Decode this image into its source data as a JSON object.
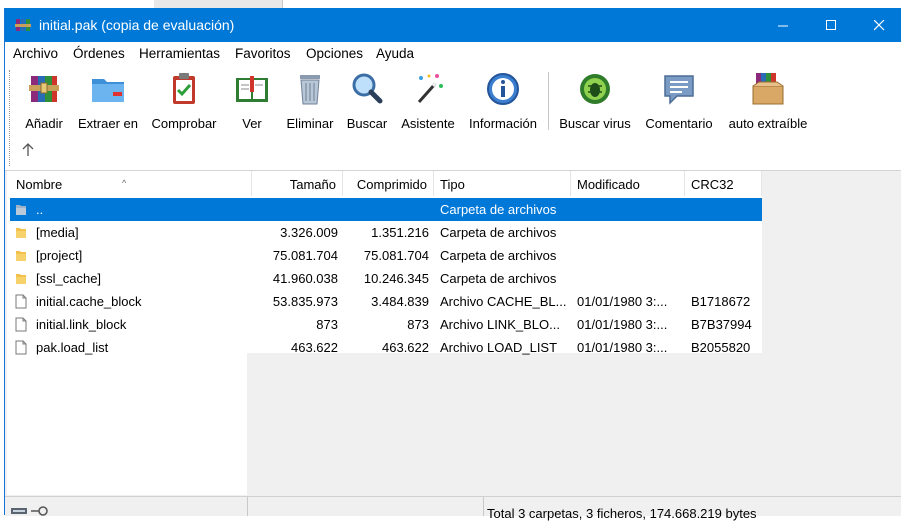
{
  "window": {
    "title": "initial.pak (copia de evaluación)"
  },
  "menu": [
    "Archivo",
    "Órdenes",
    "Herramientas",
    "Favoritos",
    "Opciones",
    "Ayuda"
  ],
  "toolbar": {
    "add": "Añadir",
    "extract": "Extraer en",
    "test": "Comprobar",
    "view": "Ver",
    "delete": "Eliminar",
    "find": "Buscar",
    "wizard": "Asistente",
    "info": "Información",
    "virus": "Buscar virus",
    "comment": "Comentario",
    "sfx": "auto extraíble"
  },
  "columns": {
    "name": "Nombre",
    "size": "Tamaño",
    "packed": "Comprimido",
    "type": "Tipo",
    "modified": "Modificado",
    "crc": "CRC32"
  },
  "files": [
    {
      "name": "..",
      "size": "",
      "packed": "",
      "type": "Carpeta de archivos",
      "modified": "",
      "crc": "",
      "icon": "parent-folder-icon",
      "selected": true
    },
    {
      "name": "[media]",
      "size": "3.326.009",
      "packed": "1.351.216",
      "type": "Carpeta de archivos",
      "modified": "",
      "crc": "",
      "icon": "folder-icon"
    },
    {
      "name": "[project]",
      "size": "75.081.704",
      "packed": "75.081.704",
      "type": "Carpeta de archivos",
      "modified": "",
      "crc": "",
      "icon": "folder-icon"
    },
    {
      "name": "[ssl_cache]",
      "size": "41.960.038",
      "packed": "10.246.345",
      "type": "Carpeta de archivos",
      "modified": "",
      "crc": "",
      "icon": "folder-icon"
    },
    {
      "name": "initial.cache_block",
      "size": "53.835.973",
      "packed": "3.484.839",
      "type": "Archivo CACHE_BL...",
      "modified": "01/01/1980 3:...",
      "crc": "B1718672",
      "icon": "file-icon"
    },
    {
      "name": "initial.link_block",
      "size": "873",
      "packed": "873",
      "type": "Archivo LINK_BLO...",
      "modified": "01/01/1980 3:...",
      "crc": "B7B37994",
      "icon": "file-icon"
    },
    {
      "name": "pak.load_list",
      "size": "463.622",
      "packed": "463.622",
      "type": "Archivo LOAD_LIST",
      "modified": "01/01/1980 3:...",
      "crc": "B2055820",
      "icon": "file-icon"
    }
  ],
  "status": {
    "summary": "Total 3 carpetas, 3 ficheros, 174.668.219 bytes"
  },
  "colors": {
    "titlebar": "#0078d7",
    "selection": "#0078d7",
    "folder": "#f2c14e"
  }
}
